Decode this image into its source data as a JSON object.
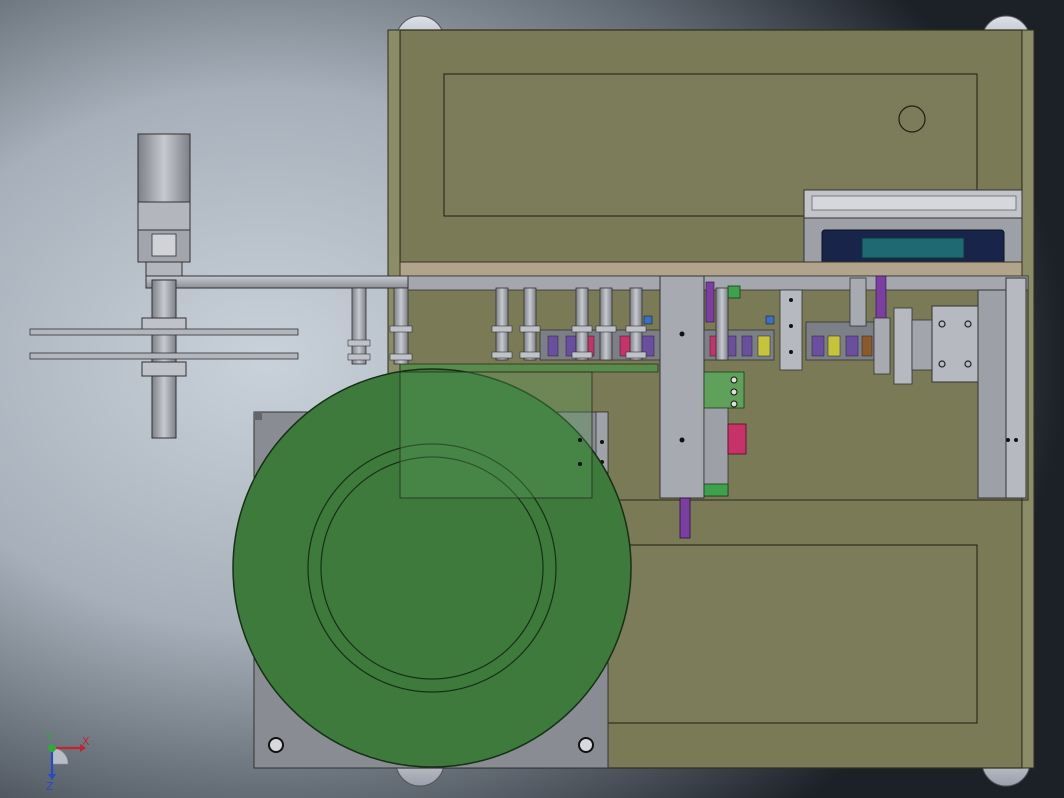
{
  "viewport": {
    "background_gradient": [
      "#1c2128",
      "#5f6770",
      "#a7b0ba",
      "#c9d1da"
    ]
  },
  "colors": {
    "frame_olive": "#7a7a56",
    "panel_olive": "#7c7b5a",
    "frame_edge": "#2d2d20",
    "steel": "#a5a7ae",
    "steel_dark": "#6f727a",
    "bowl_green": "#3d7a3c",
    "bowl_edge": "#163016",
    "rail_tan": "#b2a48c",
    "display_blue": "#18244a",
    "display_teal": "#1d6a72",
    "accent_purple": "#7b3fa1",
    "accent_pink": "#c8326a",
    "accent_yellow": "#c6c43a",
    "accent_green": "#3ea24c",
    "accent_blue": "#3b6fc4",
    "accent_brown": "#8a5a2a"
  },
  "triad": {
    "x_label": "X",
    "y_label": "Y",
    "z_label": "Z",
    "x_color": "#c0262e",
    "y_color": "#2fa83a",
    "z_color": "#2849c8"
  }
}
